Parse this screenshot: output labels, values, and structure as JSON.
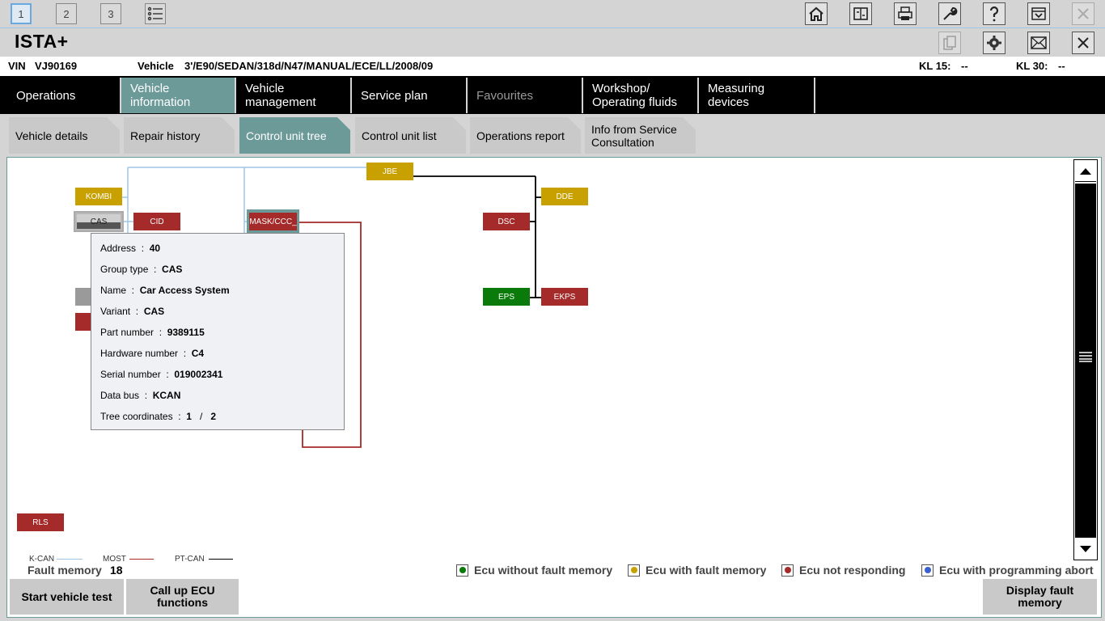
{
  "workspaces": [
    "1",
    "2",
    "3"
  ],
  "app_title": "ISTA+",
  "vehicle_info": {
    "vin_label": "VIN",
    "vin_value": "VJ90169",
    "vehicle_label": "Vehicle",
    "vehicle_value": "3'/E90/SEDAN/318d/N47/MANUAL/ECE/LL/2008/09",
    "kl15_label": "KL 15:",
    "kl15_value": "--",
    "kl30_label": "KL 30:",
    "kl30_value": "--"
  },
  "main_tabs": [
    {
      "label": "Operations"
    },
    {
      "label": "Vehicle information"
    },
    {
      "label": "Vehicle management"
    },
    {
      "label": "Service plan"
    },
    {
      "label": "Favourites"
    },
    {
      "label": "Workshop/ Operating fluids"
    },
    {
      "label": "Measuring devices"
    }
  ],
  "sub_tabs": [
    {
      "label": "Vehicle details"
    },
    {
      "label": "Repair history"
    },
    {
      "label": "Control unit tree"
    },
    {
      "label": "Control unit list"
    },
    {
      "label": "Operations report"
    },
    {
      "label": "Info from Service Consultation"
    }
  ],
  "ecus": {
    "jbe": "JBE",
    "kombi": "KOMBI",
    "cas": "CAS",
    "cid": "CID",
    "mask": "MASK/CCC_",
    "dde": "DDE",
    "dsc": "DSC",
    "eps": "EPS",
    "ekps": "EKPS",
    "rls": "RLS"
  },
  "tooltip": {
    "address": {
      "label": "Address",
      "value": "40"
    },
    "group_type": {
      "label": "Group type",
      "value": "CAS"
    },
    "name": {
      "label": "Name",
      "value": "Car Access System"
    },
    "variant": {
      "label": "Variant",
      "value": "CAS"
    },
    "part_number": {
      "label": "Part number",
      "value": "9389115"
    },
    "hardware_number": {
      "label": "Hardware number",
      "value": "C4"
    },
    "serial_number": {
      "label": "Serial number",
      "value": "019002341"
    },
    "data_bus": {
      "label": "Data bus",
      "value": "KCAN"
    },
    "tree_coordinates": {
      "label": "Tree coordinates",
      "value_x": "1",
      "separator": "/",
      "value_y": "2"
    }
  },
  "bus_legend": {
    "kcan": "K-CAN",
    "most": "MOST",
    "ptcan": "PT-CAN"
  },
  "fault_memory": {
    "label": "Fault memory",
    "count": "18"
  },
  "buttons": {
    "start_vehicle_test": "Start vehicle test",
    "call_ecu_functions": "Call up ECU functions",
    "display_fault_memory": "Display fault memory"
  },
  "status_legend": [
    {
      "label": "Ecu without fault memory",
      "color": "#0a7a0a"
    },
    {
      "label": "Ecu with fault memory",
      "color": "#c8a000"
    },
    {
      "label": "Ecu not responding",
      "color": "#a52a2a"
    },
    {
      "label": "Ecu with programming abort",
      "color": "#3a5fd0"
    }
  ],
  "colors": {
    "accent": "#6b9a99",
    "kcan_line": "#9ec5e8",
    "most_line": "#a52a2a",
    "ptcan_line": "#000000"
  }
}
